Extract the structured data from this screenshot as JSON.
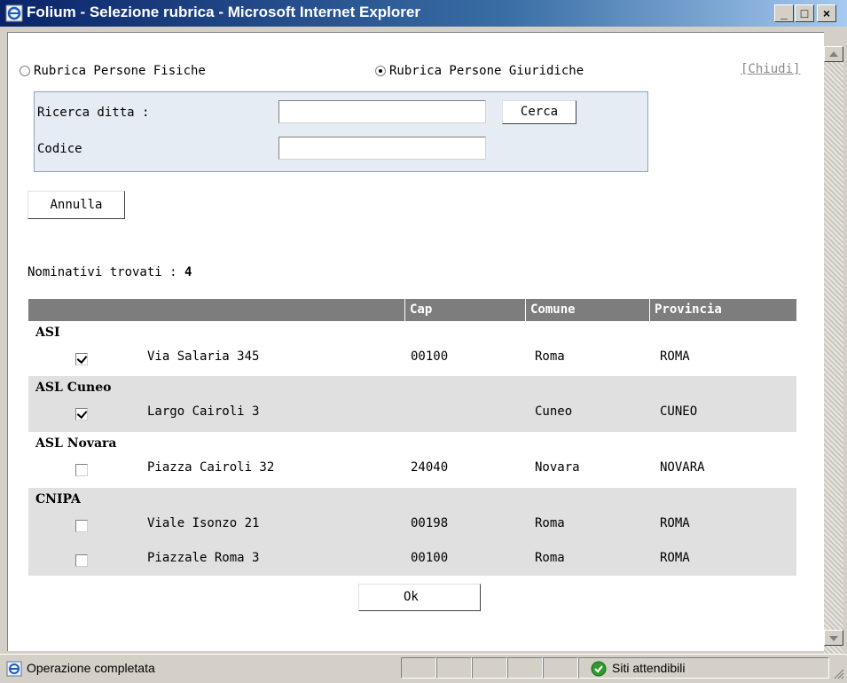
{
  "window": {
    "title": "Folium - Selezione rubrica - Microsoft Internet Explorer",
    "minimize": "_",
    "maximize": "□",
    "close": "×"
  },
  "radios": [
    {
      "label": "Rubrica Persone Fisiche",
      "checked": false
    },
    {
      "label": "Rubrica Persone Giuridiche",
      "checked": true
    }
  ],
  "close_link": "[Chiudi]",
  "search": {
    "ditta_label": "Ricerca ditta :",
    "ditta_value": "",
    "search_button": "Cerca",
    "codice_label": "Codice",
    "codice_value": ""
  },
  "cancel_button": "Annulla",
  "results": {
    "label": "Nominativi trovati :",
    "count": "4"
  },
  "table": {
    "headers": [
      "",
      "Cap",
      "Comune",
      "Provincia"
    ],
    "groups": [
      {
        "name": "ASI",
        "rows": [
          {
            "checked": true,
            "indirizzo": "Via Salaria 345",
            "cap": "00100",
            "comune": "Roma",
            "provincia": "ROMA"
          }
        ]
      },
      {
        "name": "ASL Cuneo",
        "rows": [
          {
            "checked": true,
            "indirizzo": "Largo Cairoli 3",
            "cap": "",
            "comune": "Cuneo",
            "provincia": "CUNEO"
          }
        ]
      },
      {
        "name": "ASL Novara",
        "rows": [
          {
            "checked": false,
            "indirizzo": "Piazza Cairoli 32",
            "cap": "24040",
            "comune": "Novara",
            "provincia": "NOVARA"
          }
        ]
      },
      {
        "name": "CNIPA",
        "rows": [
          {
            "checked": false,
            "indirizzo": "Viale Isonzo 21",
            "cap": "00198",
            "comune": "Roma",
            "provincia": "ROMA"
          },
          {
            "checked": false,
            "indirizzo": "Piazzale Roma 3",
            "cap": "00100",
            "comune": "Roma",
            "provincia": "ROMA"
          }
        ]
      }
    ]
  },
  "ok_button": "Ok",
  "statusbar": {
    "message": "Operazione completata",
    "zone": "Siti attendibili"
  },
  "icons": {
    "app": "ie-icon",
    "status": "ie-page-icon",
    "zone": "trusted-check-icon"
  }
}
